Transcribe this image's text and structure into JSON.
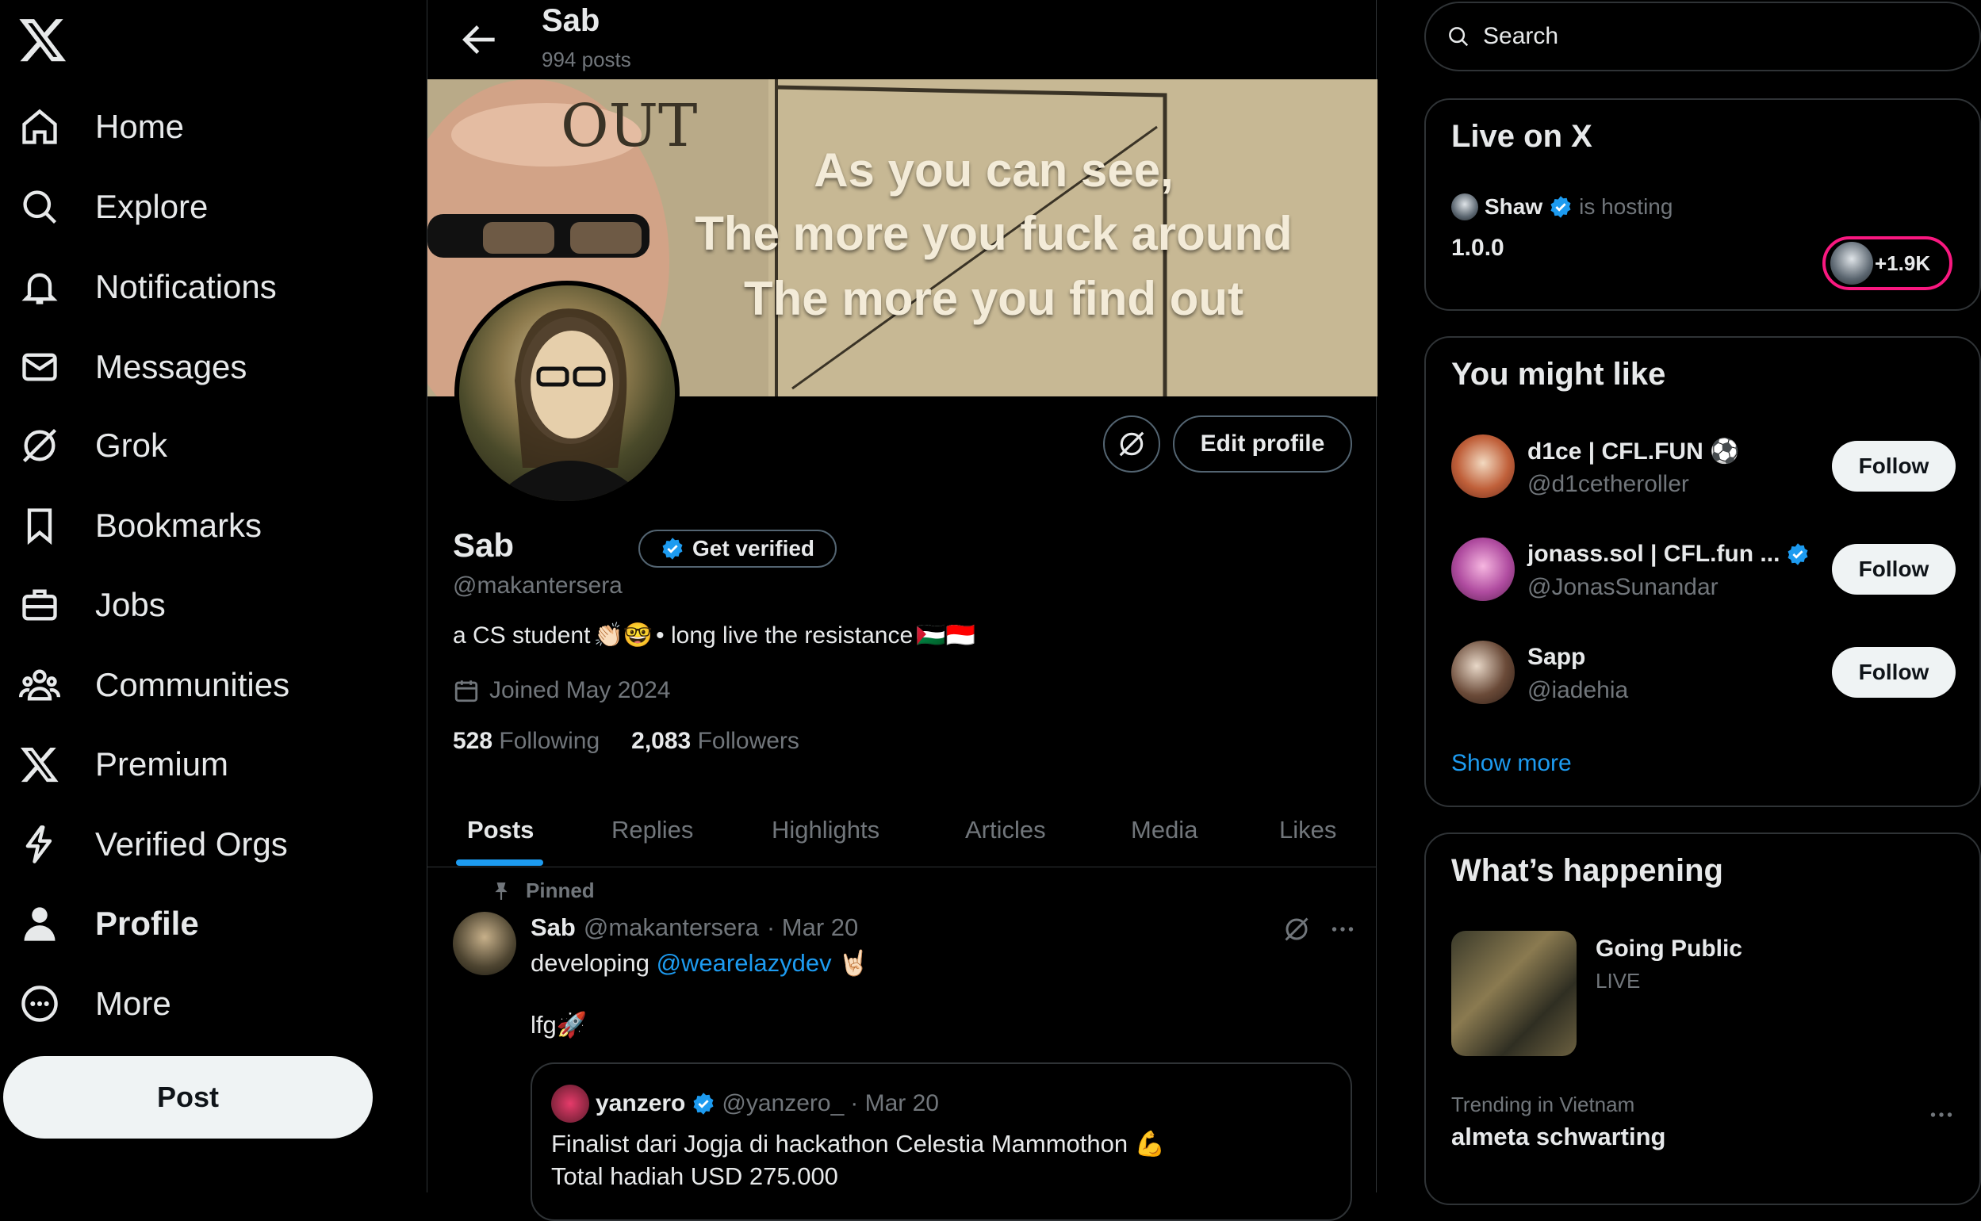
{
  "nav": {
    "items": [
      {
        "label": "Home",
        "icon": "home-icon"
      },
      {
        "label": "Explore",
        "icon": "search-icon"
      },
      {
        "label": "Notifications",
        "icon": "bell-icon"
      },
      {
        "label": "Messages",
        "icon": "envelope-icon"
      },
      {
        "label": "Grok",
        "icon": "grok-icon"
      },
      {
        "label": "Bookmarks",
        "icon": "bookmark-icon"
      },
      {
        "label": "Jobs",
        "icon": "briefcase-icon"
      },
      {
        "label": "Communities",
        "icon": "people-icon"
      },
      {
        "label": "Premium",
        "icon": "x-logo-icon"
      },
      {
        "label": "Verified Orgs",
        "icon": "lightning-icon"
      },
      {
        "label": "Profile",
        "icon": "person-icon"
      },
      {
        "label": "More",
        "icon": "more-circle-icon"
      }
    ],
    "post_label": "Post"
  },
  "header": {
    "name": "Sab",
    "post_count": "994 posts"
  },
  "banner": {
    "lines": [
      "As you can see,",
      "The more you fuck around",
      "The more you find out"
    ],
    "board_text": "OUT"
  },
  "profile": {
    "edit_label": "Edit profile",
    "name": "Sab",
    "get_verified": "Get verified",
    "handle": "@makantersera",
    "bio_start": "a CS student",
    "bio_emoji1": "👏🏻🤓",
    "bio_middle": " • long live the resistance",
    "bio_flags": "🇵🇸🇮🇩",
    "joined": "Joined May 2024",
    "following_count": "528",
    "following_label": "Following",
    "followers_count": "2,083",
    "followers_label": "Followers"
  },
  "tabs": [
    "Posts",
    "Replies",
    "Highlights",
    "Articles",
    "Media",
    "Likes"
  ],
  "post": {
    "pinned_label": "Pinned",
    "name": "Sab",
    "handle": "@makantersera",
    "date": "· Mar 20",
    "text_start": "developing ",
    "mention": "@wearelazydev",
    "emoji": " 🤘🏻",
    "text2": "lfg🚀",
    "quote": {
      "name": "yanzero",
      "handle": "@yanzero_",
      "date": "· Mar 20",
      "line1": "Finalist dari Jogja di hackathon Celestia Mammothon 💪",
      "line2": "Total hadiah USD 275.000"
    }
  },
  "search": {
    "placeholder": "Search"
  },
  "live": {
    "title": "Live on X",
    "host_name": "Shaw",
    "host_suffix": "is hosting",
    "space_title": "1.0.0",
    "listeners": "+1.9K"
  },
  "suggestions": {
    "title": "You might like",
    "items": [
      {
        "name": "d1ce | CFL.FUN ⚽",
        "handle": "@d1cetheroller",
        "follow": "Follow",
        "verified": false
      },
      {
        "name": "jonass.sol | CFL.fun ...",
        "handle": "@JonasSunandar",
        "follow": "Follow",
        "verified": true
      },
      {
        "name": "Sapp",
        "handle": "@iadehia",
        "follow": "Follow",
        "verified": false
      }
    ],
    "show_more": "Show more"
  },
  "happening": {
    "title": "What’s happening",
    "trend1_title": "Going Public",
    "trend1_status": "LIVE",
    "trend2_category": "Trending in Vietnam",
    "trend2_name": "almeta schwarting"
  },
  "colors": {
    "accent": "#1d9bf0",
    "live_ring": "#f91880",
    "background": "#000000",
    "border": "#2f3336"
  }
}
